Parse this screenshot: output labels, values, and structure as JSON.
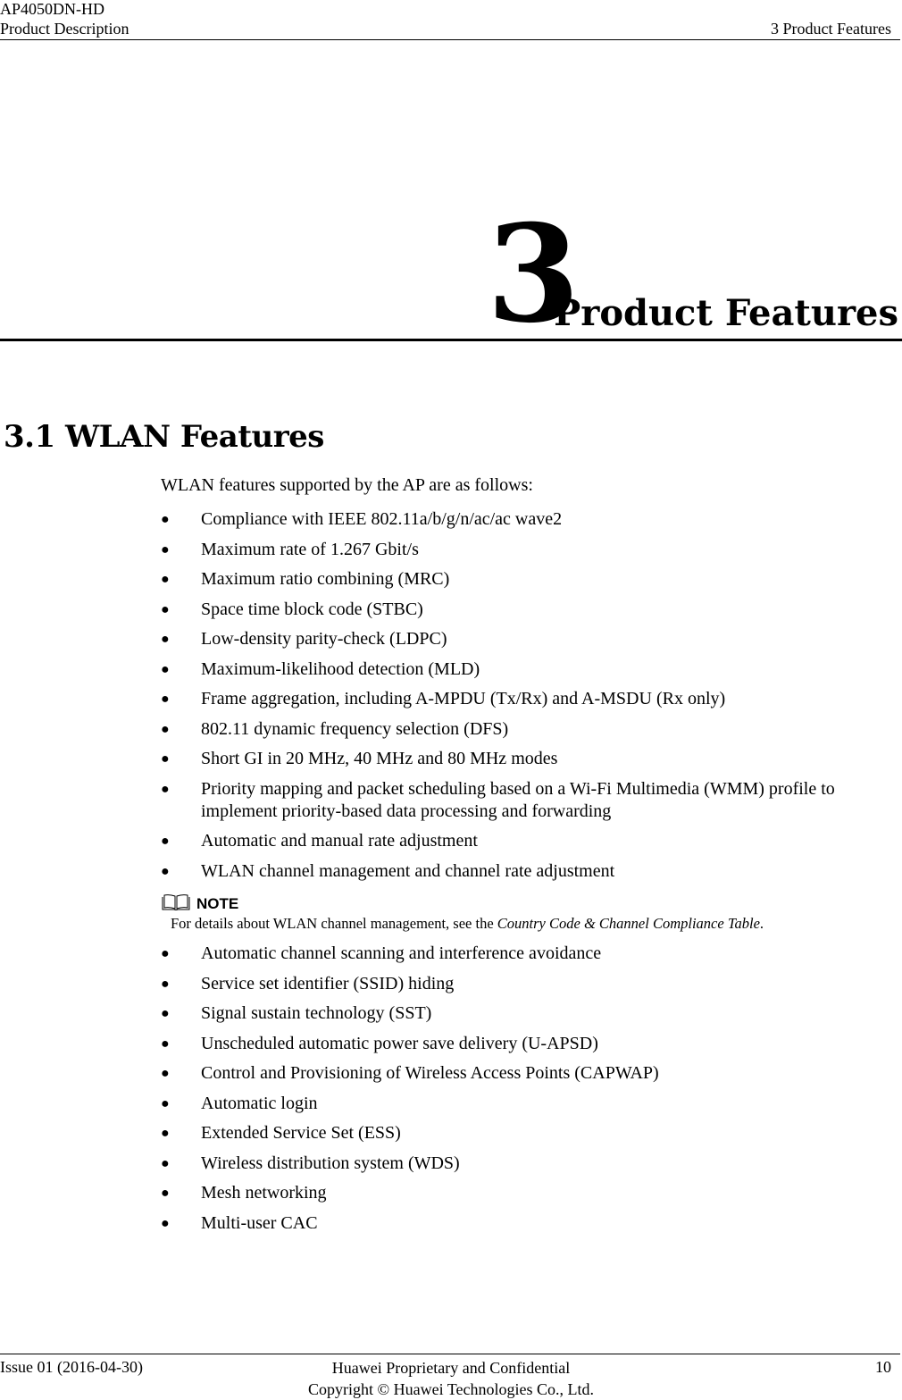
{
  "header": {
    "product": "AP4050DN-HD",
    "doc_type": "Product Description",
    "chapter_ref": "3 Product Features"
  },
  "chapter": {
    "number": "3",
    "title": "Product Features"
  },
  "section": {
    "title": "3.1 WLAN Features",
    "intro": "WLAN features supported by the AP are as follows:",
    "bullet_symbol": "●",
    "features_before_note": [
      "Compliance with IEEE 802.11a/b/g/n/ac/ac wave2",
      "Maximum rate of 1.267 Gbit/s",
      "Maximum ratio combining (MRC)",
      "Space time block code (STBC)",
      "Low-density parity-check (LDPC)",
      "Maximum-likelihood detection (MLD)",
      "Frame aggregation, including A-MPDU (Tx/Rx) and A-MSDU (Rx only)",
      "802.11 dynamic frequency selection (DFS)",
      "Short GI in 20 MHz, 40 MHz and 80 MHz modes",
      "Priority mapping and packet scheduling based on a Wi-Fi Multimedia (WMM) profile to implement priority-based data processing and forwarding",
      "Automatic and manual rate adjustment",
      "WLAN channel management and channel rate adjustment"
    ],
    "note": {
      "icon": "book-icon",
      "label": "NOTE",
      "text_prefix": "For details about WLAN channel management, see the ",
      "text_ref": "Country Code & Channel Compliance Table",
      "text_suffix": "."
    },
    "features_after_note": [
      "Automatic channel scanning and interference avoidance",
      "Service set identifier (SSID) hiding",
      "Signal sustain technology (SST)",
      "Unscheduled automatic power save delivery (U-APSD)",
      "Control and Provisioning of Wireless Access Points (CAPWAP)",
      "Automatic login",
      "Extended Service Set (ESS)",
      "Wireless distribution system (WDS)",
      "Mesh networking",
      "Multi-user CAC"
    ]
  },
  "footer": {
    "issue": "Issue 01 (2016-04-30)",
    "confidential": "Huawei Proprietary and Confidential",
    "copyright": "Copyright © Huawei Technologies Co., Ltd.",
    "page_number": "10"
  }
}
